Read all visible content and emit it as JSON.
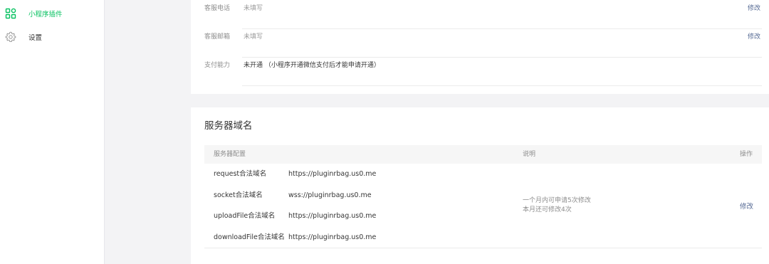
{
  "sidebar": {
    "items": [
      {
        "label": "小程序插件",
        "icon": "plugin-grid-icon",
        "active": true
      },
      {
        "label": "设置",
        "icon": "gear-icon",
        "active": false
      }
    ]
  },
  "info": {
    "rows": [
      {
        "key": "客服电话",
        "value": "未填写",
        "action": "修改"
      },
      {
        "key": "客服邮箱",
        "value": "未填写",
        "action": "修改"
      },
      {
        "key": "支付能力",
        "value": "未开通 （小程序开通微信支付后才能申请开通）"
      }
    ]
  },
  "server": {
    "title": "服务器域名",
    "headers": {
      "config": "服务器配置",
      "desc": "说明",
      "op": "操作"
    },
    "rows": [
      {
        "name": "request合法域名",
        "value": "https://pluginrbag.us0.me"
      },
      {
        "name": "socket合法域名",
        "value": "wss://pluginrbag.us0.me"
      },
      {
        "name": "uploadFile合法域名",
        "value": "https://pluginrbag.us0.me"
      },
      {
        "name": "downloadFile合法域名",
        "value": "https://pluginrbag.us0.me"
      }
    ],
    "desc_line1": "一个月内可申请5次修改",
    "desc_line2": "本月还可修改4次",
    "op_label": "修改"
  },
  "colors": {
    "accent": "#07c160",
    "link": "#576b95"
  }
}
